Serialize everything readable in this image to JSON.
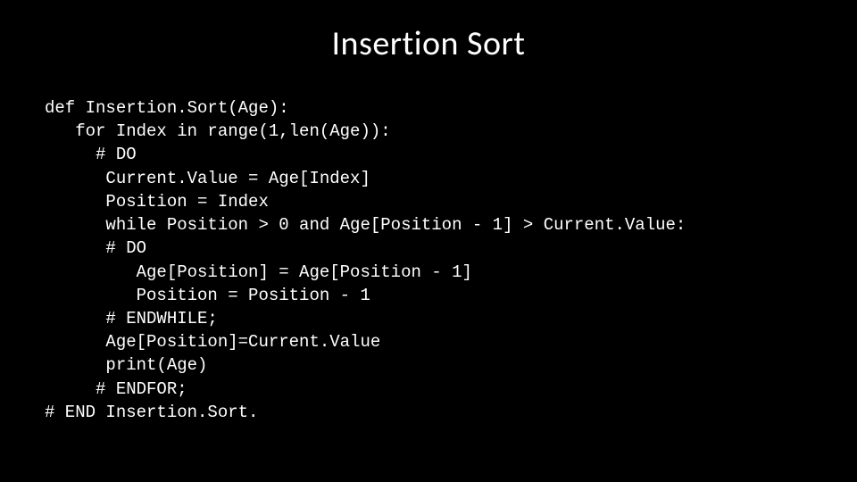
{
  "title": "Insertion Sort",
  "code": "def Insertion.Sort(Age):\n   for Index in range(1,len(Age)):\n     # DO\n      Current.Value = Age[Index]\n      Position = Index\n      while Position > 0 and Age[Position - 1] > Current.Value:\n      # DO\n         Age[Position] = Age[Position - 1]\n         Position = Position - 1\n      # ENDWHILE;\n      Age[Position]=Current.Value\n      print(Age)\n     # ENDFOR;\n# END Insertion.Sort."
}
